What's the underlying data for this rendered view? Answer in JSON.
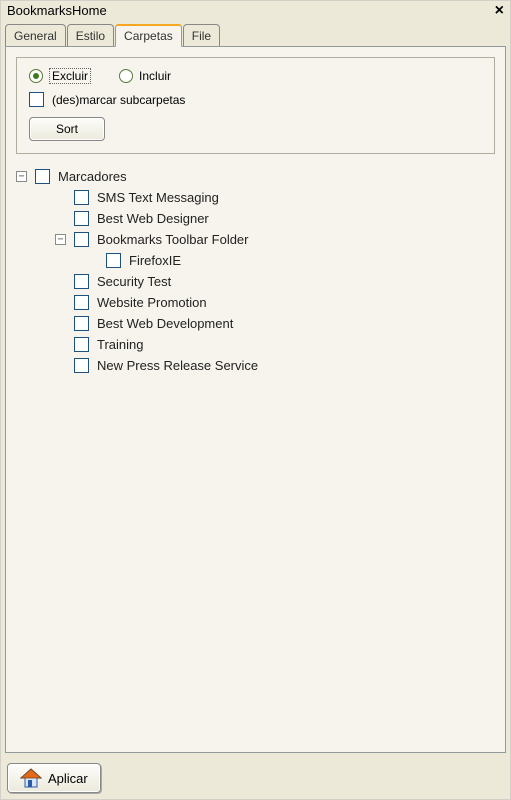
{
  "window": {
    "title": "BookmarksHome"
  },
  "tabs": {
    "general": "General",
    "estilo": "Estilo",
    "carpetas": "Carpetas",
    "file": "File"
  },
  "options": {
    "excluir": "Excluir",
    "incluir": "Incluir",
    "des_marcar": "(des)marcar subcarpetas",
    "sort": "Sort"
  },
  "tree": {
    "root": "Marcadores",
    "items": [
      "SMS Text Messaging",
      "Best Web Designer"
    ],
    "toolbar_folder": "Bookmarks Toolbar Folder",
    "toolbar_child": "FirefoxIE",
    "rest": [
      "Security Test",
      "Website Promotion",
      "Best Web Development",
      "Training",
      "New Press Release Service"
    ]
  },
  "footer": {
    "apply": "Aplicar"
  }
}
